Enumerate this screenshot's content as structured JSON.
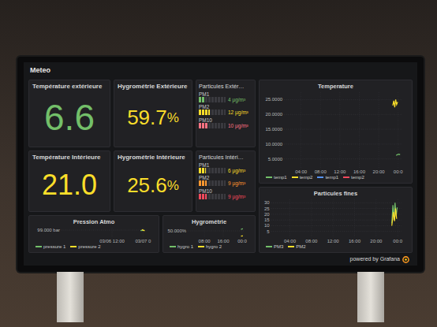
{
  "dashboard": {
    "title": "Meteo",
    "footer": "powered by Grafana"
  },
  "outdoor": {
    "temperature": {
      "title": "Température extérieure",
      "value": "6.6",
      "color": "#73bf69"
    },
    "humidity": {
      "title": "Hygrométrie Extérieure",
      "value": "59.7",
      "unit": "%",
      "color": "#fade2a"
    },
    "particles": {
      "title": "Particules Extér…",
      "rows": [
        {
          "label": "PM1",
          "value": "4 µg/m³",
          "level": 0.2,
          "color": "#73bf69"
        },
        {
          "label": "PM2",
          "value": "12 µg/m³",
          "level": 0.4,
          "color": "#fade2a"
        },
        {
          "label": "PM10",
          "value": "10 µg/m³",
          "level": 0.35,
          "color": "#ff7383"
        }
      ]
    }
  },
  "indoor": {
    "temperature": {
      "title": "Température Intérieure",
      "value": "21.0",
      "color": "#fade2a"
    },
    "humidity": {
      "title": "Hygrométrie Intérieure",
      "value": "25.6",
      "unit": "%",
      "color": "#fade2a"
    },
    "particles": {
      "title": "Particules Intéri…",
      "rows": [
        {
          "label": "PM1",
          "value": "6 µg/m³",
          "level": 0.25,
          "color": "#fade2a"
        },
        {
          "label": "PM2",
          "value": "9 µg/m³",
          "level": 0.3,
          "color": "#ff9830"
        },
        {
          "label": "PM10",
          "value": "9 µg/m³",
          "level": 0.3,
          "color": "#f2495c"
        }
      ]
    }
  },
  "charts": {
    "temperature": {
      "title": "Temperature",
      "x_range": [
        0.5,
        24.7
      ],
      "y_range": [
        2,
        27.5
      ],
      "y_ticks": [
        {
          "label": "25.0000",
          "value": 25
        },
        {
          "label": "20.0000",
          "value": 20
        },
        {
          "label": "15.0000",
          "value": 15
        },
        {
          "label": "10.0000",
          "value": 10
        },
        {
          "label": "5.0000",
          "value": 5
        }
      ],
      "x_ticks": [
        {
          "label": "04:00",
          "value": 4
        },
        {
          "label": "08:00",
          "value": 8
        },
        {
          "label": "12:00",
          "value": 12
        },
        {
          "label": "16:00",
          "value": 16
        },
        {
          "label": "20:00",
          "value": 20
        },
        {
          "label": "00:0",
          "value": 24
        }
      ],
      "series": [
        {
          "name": "temp1",
          "color": "#73bf69",
          "points": [
            [
              23.6,
              6.2
            ],
            [
              23.9,
              6.5
            ],
            [
              24.2,
              6.6
            ],
            [
              24.4,
              6.4
            ]
          ]
        },
        {
          "name": "temp2",
          "color": "#fade2a",
          "points": [
            [
              22.9,
              23.0
            ],
            [
              23.1,
              24.6
            ],
            [
              23.3,
              22.4
            ],
            [
              23.5,
              25.0
            ],
            [
              23.7,
              23.3
            ],
            [
              23.9,
              24.2
            ]
          ]
        },
        {
          "name": "temp1",
          "color": "#5794f2",
          "points": []
        },
        {
          "name": "temp2",
          "color": "#f2495c",
          "points": []
        }
      ]
    },
    "fine_particles": {
      "title": "Particules fines",
      "x_range": [
        0.5,
        24.7
      ],
      "y_range": [
        0,
        33
      ],
      "y_ticks": [
        {
          "label": "30",
          "value": 30
        },
        {
          "label": "25",
          "value": 25
        },
        {
          "label": "20",
          "value": 20
        },
        {
          "label": "15",
          "value": 15
        },
        {
          "label": "10",
          "value": 10
        },
        {
          "label": "5",
          "value": 5
        }
      ],
      "x_ticks": [
        {
          "label": "04:00",
          "value": 4
        },
        {
          "label": "08:00",
          "value": 8
        },
        {
          "label": "12:00",
          "value": 12
        },
        {
          "label": "16:00",
          "value": 16
        },
        {
          "label": "20:00",
          "value": 20
        },
        {
          "label": "00:0",
          "value": 24
        }
      ],
      "series": [
        {
          "name": "PM3",
          "color": "#73bf69",
          "points": [
            [
              22.9,
              12
            ],
            [
              23.1,
              28
            ],
            [
              23.3,
              15
            ],
            [
              23.5,
              30
            ],
            [
              23.7,
              18
            ],
            [
              23.9,
              26
            ]
          ]
        },
        {
          "name": "PM2",
          "color": "#fade2a",
          "points": [
            [
              22.9,
              10
            ],
            [
              23.2,
              22
            ],
            [
              23.4,
              14
            ],
            [
              23.6,
              25
            ],
            [
              23.8,
              16
            ]
          ]
        }
      ]
    },
    "pressure": {
      "title": "Pression Atmo",
      "x_range": [
        -7.5,
        26
      ],
      "y_range": [
        96,
        100
      ],
      "y_ticks": [
        {
          "label": "99.000 bar",
          "value": 99
        }
      ],
      "x_ticks": [
        {
          "label": "03/06 12:00",
          "value": 12
        },
        {
          "label": "03/07 0",
          "value": 24
        }
      ],
      "series": [
        {
          "name": "pressure 1",
          "color": "#73bf69",
          "points": [
            [
              23.0,
              98.8
            ],
            [
              24.3,
              98.9
            ]
          ]
        },
        {
          "name": "pressure 2",
          "color": "#fade2a",
          "points": [
            [
              23.5,
              99.2
            ],
            [
              24.6,
              98.7
            ]
          ]
        }
      ]
    },
    "humidity": {
      "title": "Hygrométrie",
      "x_range": [
        1,
        25
      ],
      "y_range": [
        20,
        65
      ],
      "y_ticks": [
        {
          "label": "50.000%",
          "value": 50
        }
      ],
      "x_ticks": [
        {
          "label": "08:00",
          "value": 8
        },
        {
          "label": "16:00",
          "value": 16
        },
        {
          "label": "00:0",
          "value": 24
        }
      ],
      "series": [
        {
          "name": "hygro 1",
          "color": "#73bf69",
          "points": [
            [
              23.5,
              57
            ],
            [
              24.3,
              60
            ]
          ]
        },
        {
          "name": "hygro 2",
          "color": "#fade2a",
          "points": [
            [
              23.5,
              25
            ],
            [
              24.3,
              26
            ]
          ]
        }
      ]
    }
  }
}
